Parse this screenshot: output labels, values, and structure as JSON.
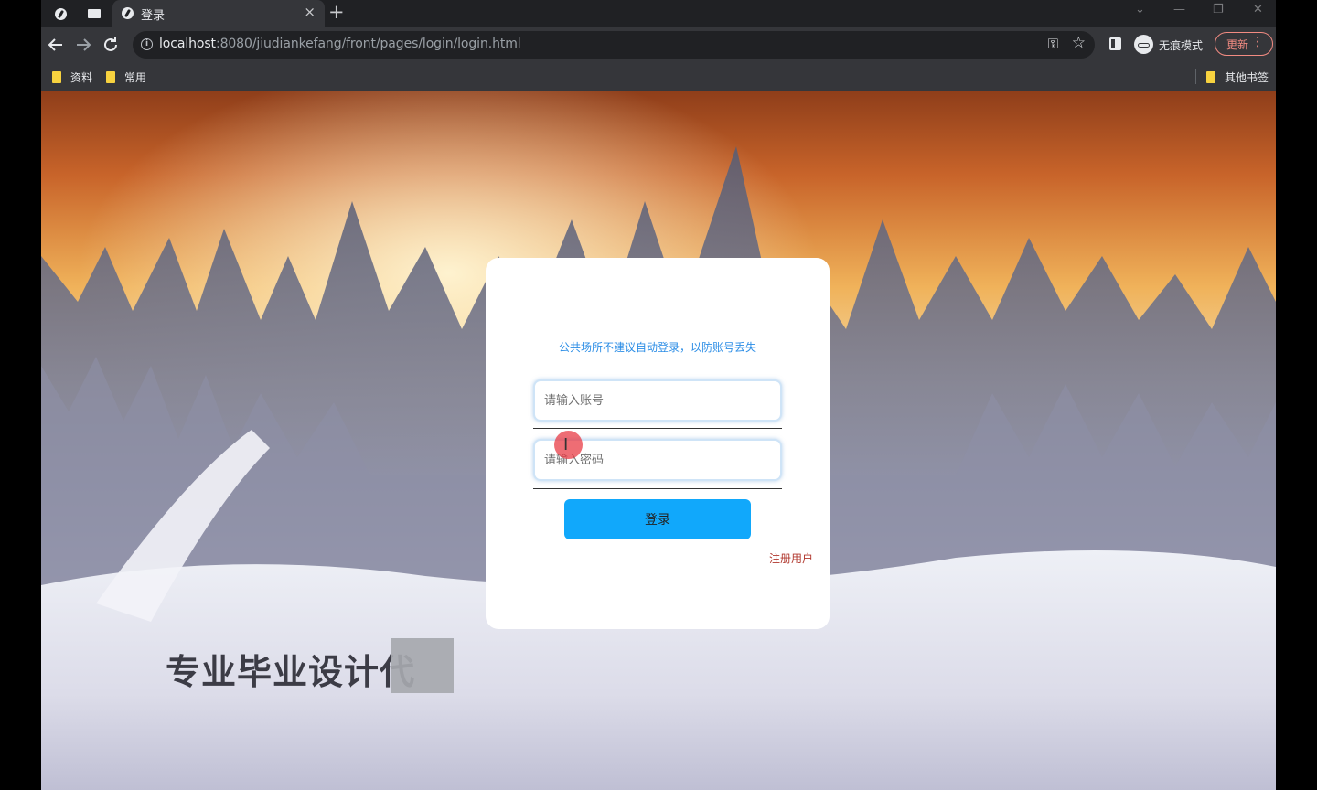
{
  "browser": {
    "tab_title": "登录",
    "tab_close": "×",
    "new_tab": "+",
    "window_controls": [
      "⌄",
      "—",
      "❐",
      "✕"
    ],
    "url_host": "localhost",
    "url_rest": ":8080/jiudiankefang/front/pages/login/login.html",
    "incognito_label": "无痕模式",
    "update_label": "更新",
    "update_menu": "⋮",
    "bookmarks": [
      "资料",
      "常用"
    ],
    "other_bookmarks": "其他书签"
  },
  "login": {
    "tip": "公共场所不建议自动登录，以防账号丢失",
    "username_placeholder": "请输入账号",
    "password_placeholder": "请输入密码",
    "login_button": "登录",
    "register_link": "注册用户"
  },
  "overlay": {
    "watermark_text": "专业毕业设计代",
    "cursor_glyph": "I"
  },
  "colors": {
    "chrome_dark": "#202124",
    "chrome_toolbar": "#35363a",
    "tip_text": "#2d8ee6",
    "login_button": "#11a8fb",
    "register_link": "#b0372d",
    "update_accent": "#f28b82"
  }
}
